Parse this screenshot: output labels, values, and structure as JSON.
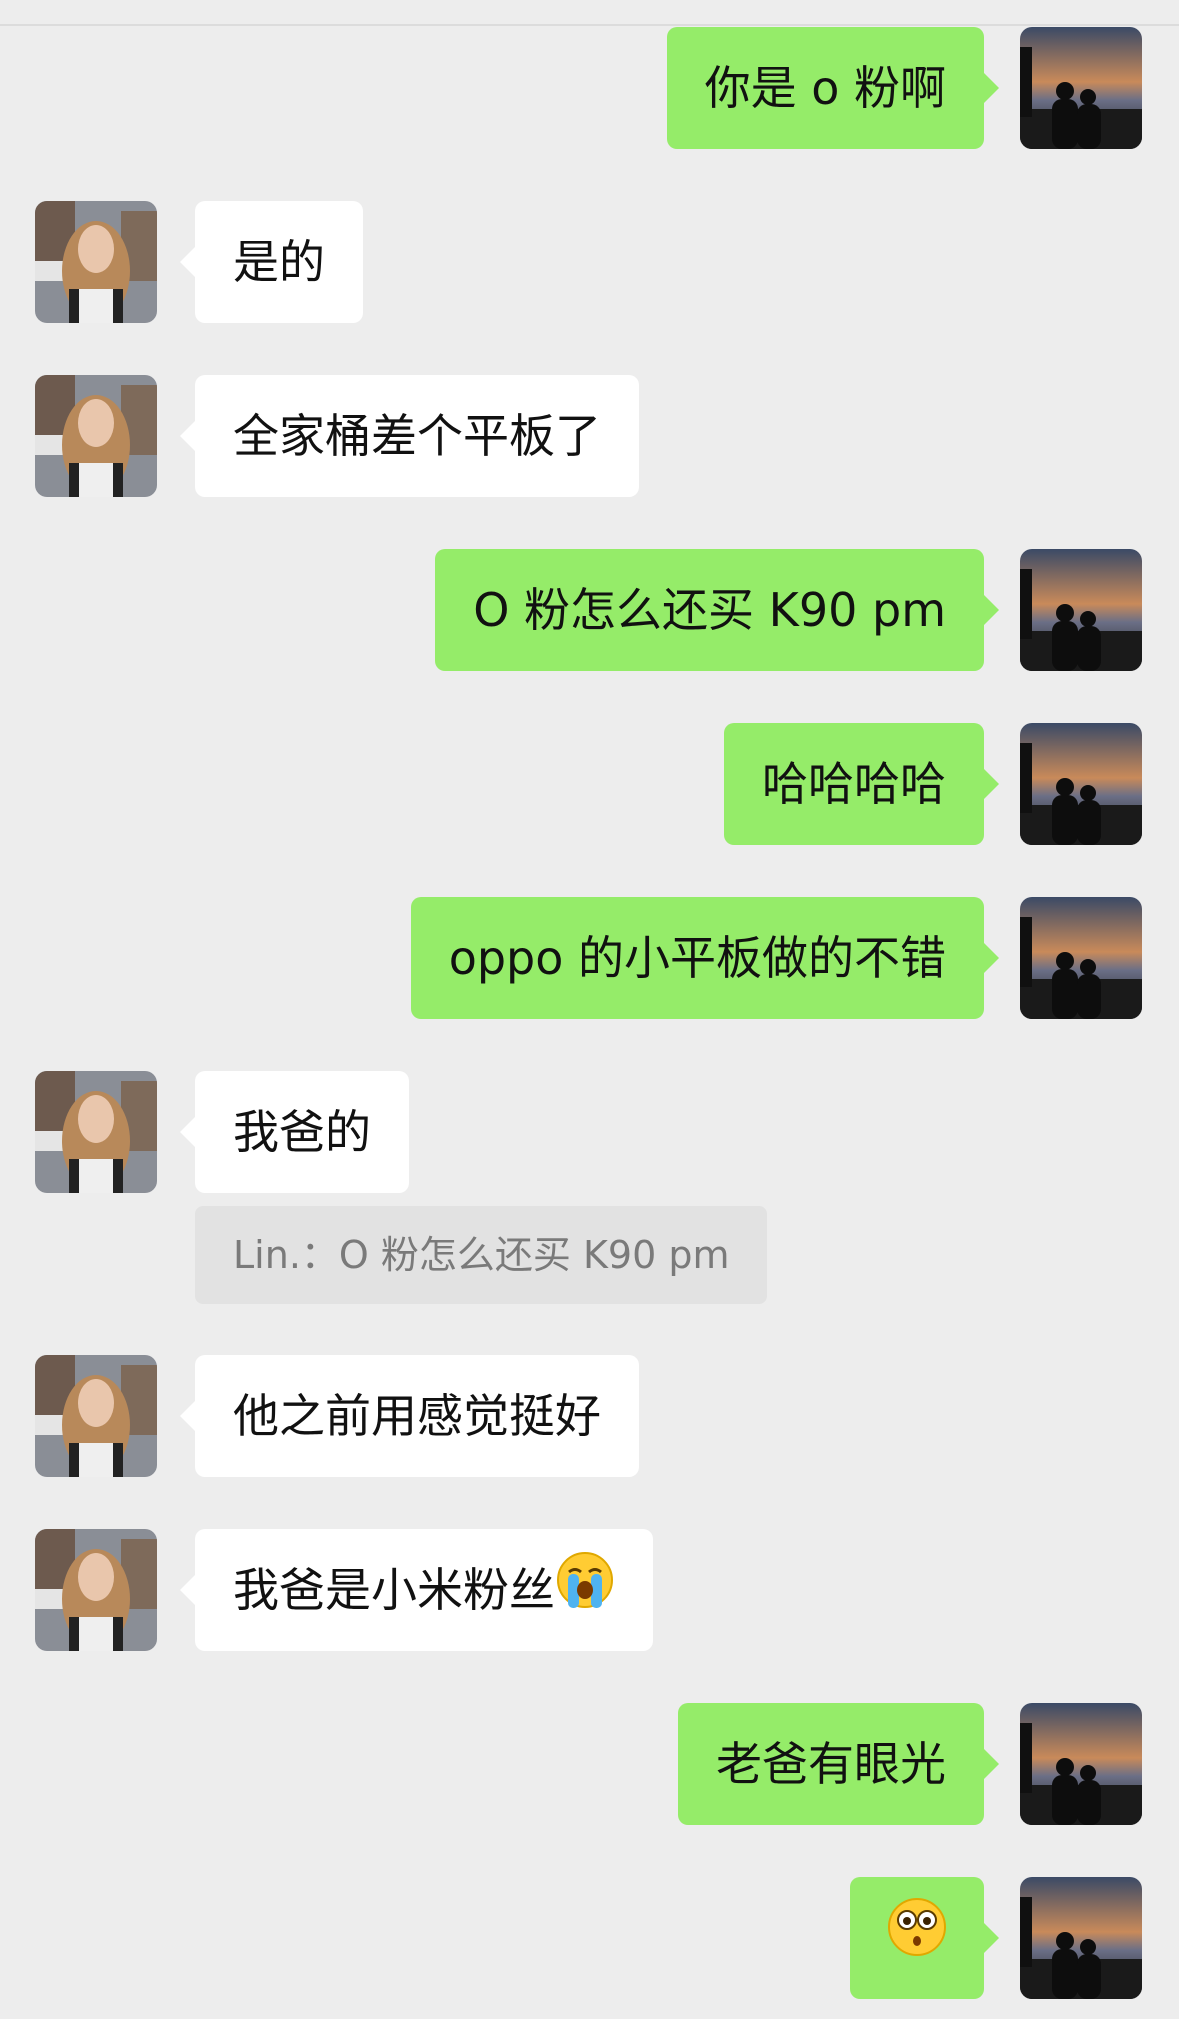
{
  "messages": [
    {
      "side": "me",
      "text": "你是 o 粉啊"
    },
    {
      "side": "them",
      "text": "是的"
    },
    {
      "side": "them",
      "text": "全家桶差个平板了"
    },
    {
      "side": "me",
      "text": "O 粉怎么还买 K90 pm"
    },
    {
      "side": "me",
      "text": "哈哈哈哈"
    },
    {
      "side": "me",
      "text": "oppo 的小平板做的不错"
    },
    {
      "side": "them",
      "text": "我爸的",
      "quote": {
        "sender": "Lin.：",
        "text": "O 粉怎么还买 K90 pm"
      }
    },
    {
      "side": "them",
      "text": "他之前用感觉挺好"
    },
    {
      "side": "them",
      "text": "我爸是小米粉丝",
      "emoji": "loudly-crying-face"
    },
    {
      "side": "me",
      "text": "老爸有眼光"
    },
    {
      "side": "me",
      "text": "",
      "emoji": "flushed-face"
    }
  ],
  "colors": {
    "background": "#ededed",
    "my_bubble": "#95ec69",
    "their_bubble": "#ffffff",
    "quote_bg": "#e2e2e2"
  }
}
